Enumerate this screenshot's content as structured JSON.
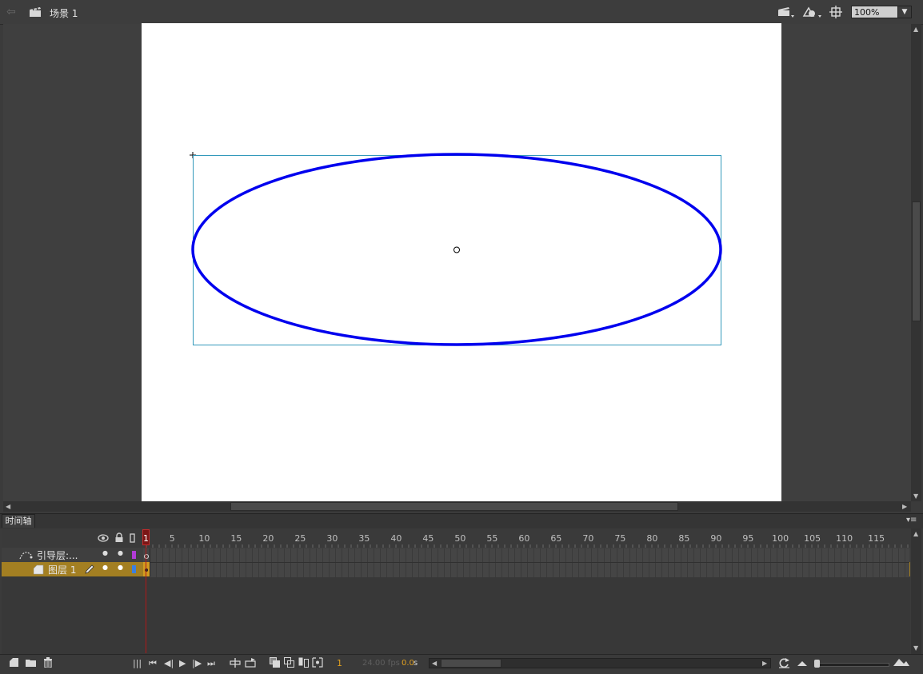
{
  "editbar": {
    "scene_label": "场景 1",
    "zoom_value": "100%"
  },
  "timeline": {
    "tab_label": "时间轴",
    "frame_numbers": [
      "1",
      "5",
      "10",
      "15",
      "20",
      "25",
      "30",
      "35",
      "40",
      "45",
      "50",
      "55",
      "60",
      "65",
      "70",
      "75",
      "80",
      "85",
      "90",
      "95",
      "100",
      "105",
      "110",
      "115"
    ],
    "layers": [
      {
        "name": "引导层:...",
        "type": "guide",
        "color": "#b23bd6"
      },
      {
        "name": "图层 1",
        "type": "normal",
        "color": "#3b7fe0",
        "selected": true
      }
    ]
  },
  "bottom_bar": {
    "current_frame": "1",
    "fps": "24.00 fps",
    "elapsed": "0.0",
    "elapsed_unit": "s"
  },
  "stage_content": {
    "ellipse_stroke_color": "#0000ee",
    "selection_box_color": "#3399bb"
  }
}
